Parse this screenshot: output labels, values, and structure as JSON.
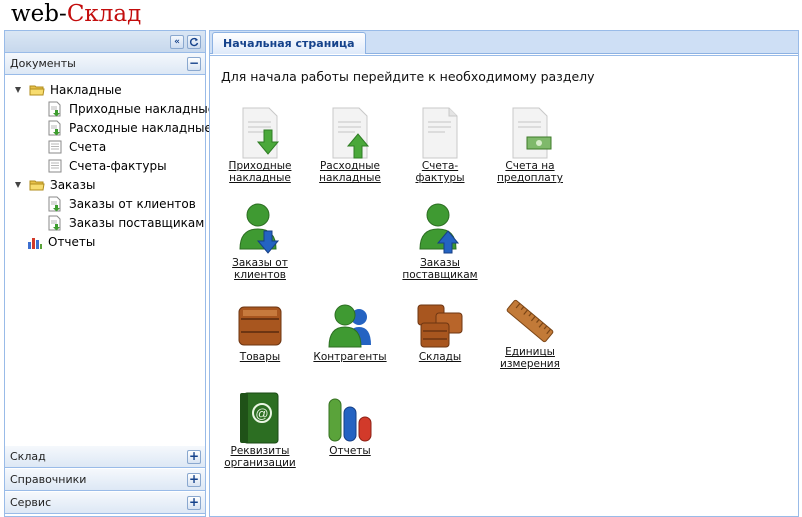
{
  "header": {
    "logo_prefix": "web",
    "logo_dash": "-",
    "logo_brand": "Склад",
    "brand_color": "#c30d0d"
  },
  "sidebar": {
    "documents_section": {
      "title": "Документы",
      "tree": [
        {
          "label": "Накладные",
          "icon": "folder-icon"
        },
        {
          "label": "Приходные накладные",
          "icon": "document-arrow-icon"
        },
        {
          "label": "Расходные накладные",
          "icon": "document-arrow-icon"
        },
        {
          "label": "Счета",
          "icon": "document-icon"
        },
        {
          "label": "Счета-фактуры",
          "icon": "document-icon"
        },
        {
          "label": "Заказы",
          "icon": "folder-icon"
        },
        {
          "label": "Заказы от клиентов",
          "icon": "document-arrow-icon"
        },
        {
          "label": "Заказы поставщикам",
          "icon": "document-arrow-icon"
        },
        {
          "label": "Отчеты",
          "icon": "bar-chart-icon"
        }
      ]
    },
    "collapsed_sections": [
      {
        "title": "Склад"
      },
      {
        "title": "Справочники"
      },
      {
        "title": "Сервис"
      }
    ]
  },
  "main": {
    "tab_label": "Начальная страница",
    "intro": "Для начала работы перейдите к необходимому разделу",
    "tiles": [
      {
        "line1": "Приходные",
        "line2": "накладные",
        "icon": "incoming-invoice-icon"
      },
      {
        "line1": "Расходные",
        "line2": "накладные",
        "icon": "outgoing-invoice-icon"
      },
      {
        "line1": "Счета-",
        "line2": "фактуры",
        "icon": "invoice-document-icon"
      },
      {
        "line1": "Счета на",
        "line2": "предоплату",
        "icon": "prepayment-document-icon"
      },
      {
        "line1": "Заказы от",
        "line2": "клиентов",
        "icon": "client-orders-icon"
      },
      {
        "line1": "Заказы",
        "line2": "поставщикам",
        "icon": "supplier-orders-icon"
      },
      {
        "line1": "Товары",
        "line2": "",
        "icon": "goods-box-icon"
      },
      {
        "line1": "Контрагенты",
        "line2": "",
        "icon": "contractors-icon"
      },
      {
        "line1": "Склады",
        "line2": "",
        "icon": "warehouses-icon"
      },
      {
        "line1": "Единицы",
        "line2": "измерения",
        "icon": "ruler-icon"
      },
      {
        "line1": "Реквизиты",
        "line2": "организации",
        "icon": "address-book-icon"
      },
      {
        "line1": "Отчеты",
        "line2": "",
        "icon": "reports-chart-icon"
      }
    ]
  }
}
